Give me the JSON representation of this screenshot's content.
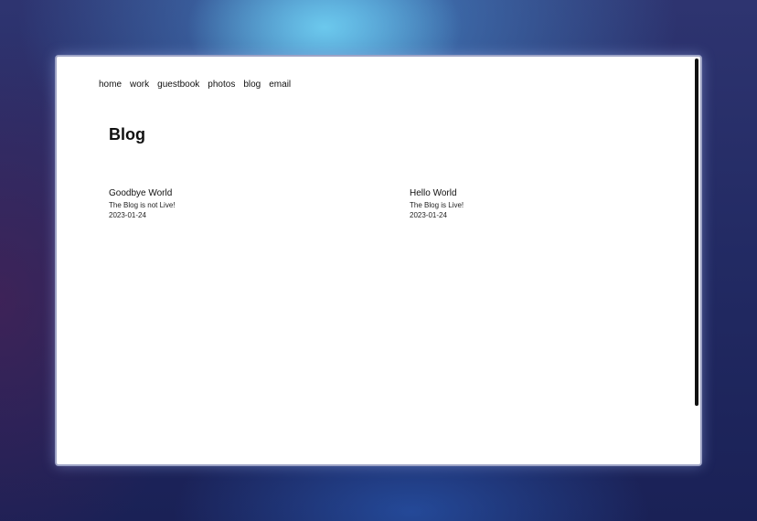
{
  "nav": {
    "items": [
      {
        "label": "home"
      },
      {
        "label": "work"
      },
      {
        "label": "guestbook"
      },
      {
        "label": "photos"
      },
      {
        "label": "blog"
      },
      {
        "label": "email"
      }
    ]
  },
  "page": {
    "title": "Blog"
  },
  "posts": [
    {
      "title": "Goodbye World",
      "description": "The Blog is not Live!",
      "date": "2023-01-24"
    },
    {
      "title": "Hello World",
      "description": "The Blog is Live!",
      "date": "2023-01-24"
    }
  ]
}
